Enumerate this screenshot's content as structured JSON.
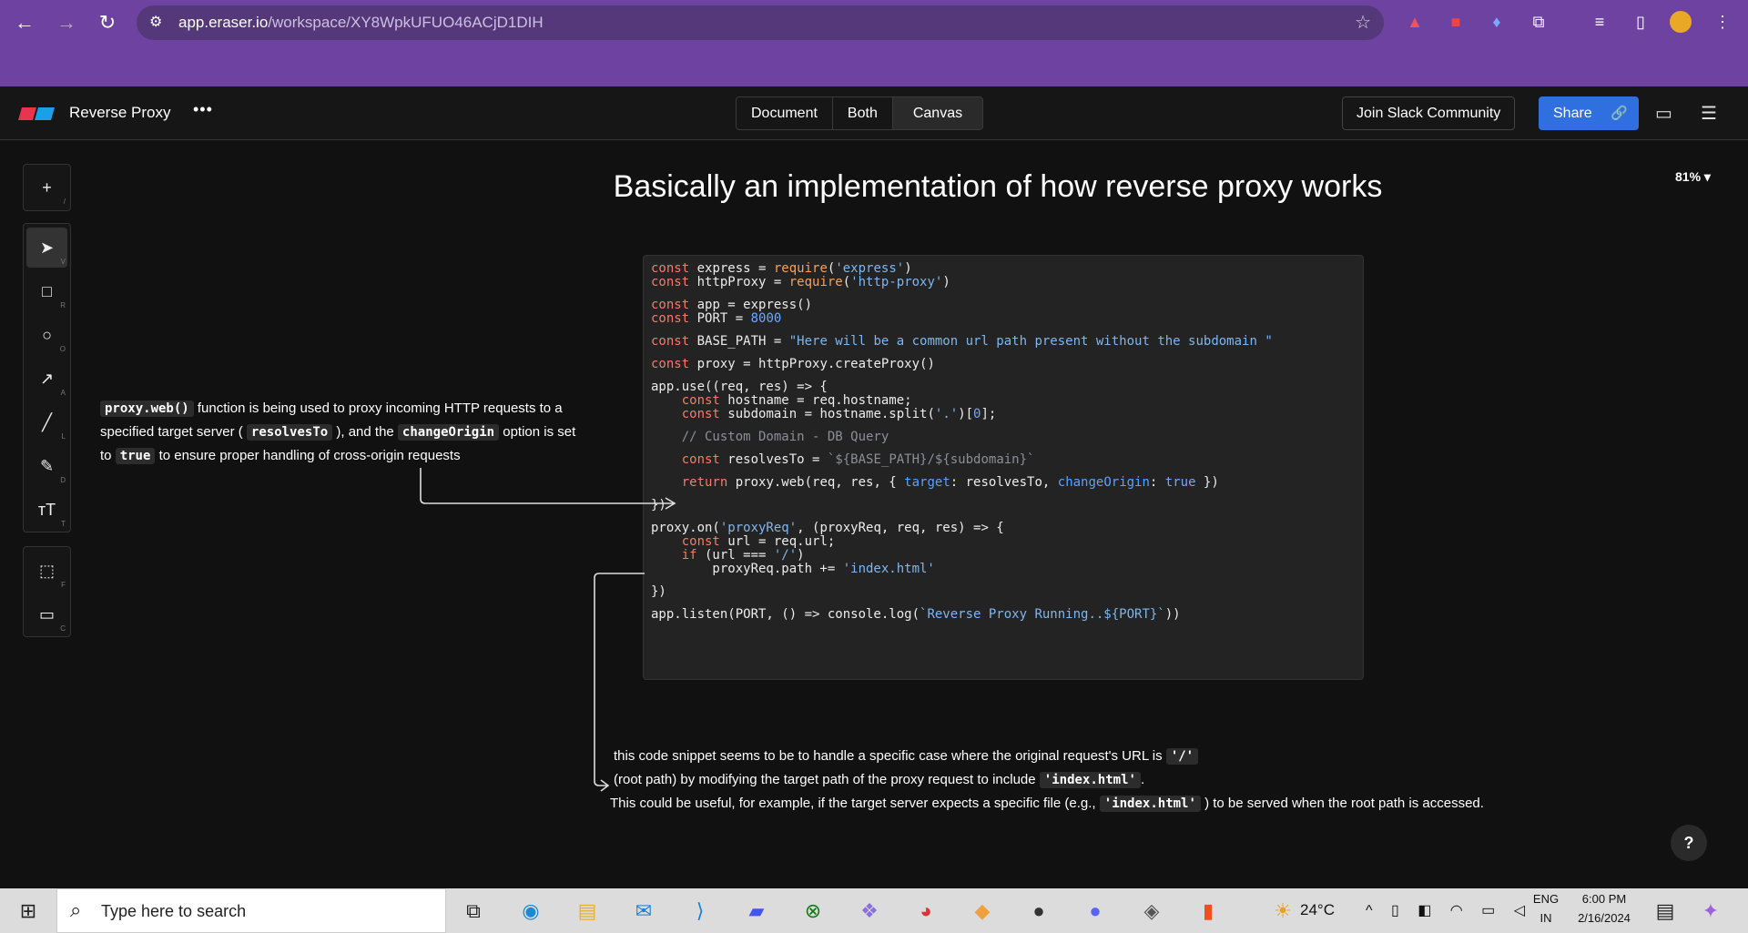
{
  "browser": {
    "url_host": "app.eraser.io",
    "url_path": "/workspace/XY8WpkUFUO46ACjD1DIH"
  },
  "header": {
    "title": "Reverse Proxy",
    "more": "•••",
    "views": [
      "Document",
      "Both",
      "Canvas"
    ],
    "active_view": "Canvas",
    "slack": "Join Slack Community",
    "share": "Share"
  },
  "toolbar": {
    "add_shortcut": "/",
    "tools": [
      {
        "icon": "cursor-icon",
        "key": "V"
      },
      {
        "icon": "rectangle-icon",
        "key": "R"
      },
      {
        "icon": "circle-icon",
        "key": "O"
      },
      {
        "icon": "arrow-icon",
        "key": "A"
      },
      {
        "icon": "line-icon",
        "key": "L"
      },
      {
        "icon": "pencil-icon",
        "key": "D"
      },
      {
        "icon": "text-icon",
        "key": "T"
      }
    ],
    "extra": [
      {
        "icon": "frame-icon",
        "key": "F"
      },
      {
        "icon": "comment-icon",
        "key": "C"
      }
    ]
  },
  "canvas": {
    "title": "Basically an implementation of how reverse proxy works",
    "zoom": "81%",
    "code": [
      [
        [
          "const",
          "kw"
        ],
        [
          " express = ",
          ""
        ],
        [
          "require",
          "fn"
        ],
        [
          "(",
          ""
        ],
        [
          "'express'",
          "st"
        ],
        [
          ")",
          ""
        ]
      ],
      [
        [
          "const",
          "kw"
        ],
        [
          " httpProxy = ",
          ""
        ],
        [
          "require",
          "fn"
        ],
        [
          "(",
          ""
        ],
        [
          "'http-proxy'",
          "st"
        ],
        [
          ")",
          ""
        ]
      ],
      [],
      [
        [
          "const",
          "kw"
        ],
        [
          " app = express()",
          ""
        ]
      ],
      [
        [
          "const",
          "kw"
        ],
        [
          " PORT = ",
          ""
        ],
        [
          "8000",
          "nm"
        ]
      ],
      [],
      [
        [
          "const",
          "kw"
        ],
        [
          " BASE_PATH = ",
          ""
        ],
        [
          "\"Here will be a common url path present without the subdomain \"",
          "st"
        ]
      ],
      [],
      [
        [
          "const",
          "kw"
        ],
        [
          " proxy = httpProxy.createProxy()",
          ""
        ]
      ],
      [],
      [
        [
          "app.use((req, res) => {",
          ""
        ]
      ],
      [
        [
          "    ",
          ""
        ],
        [
          "const",
          "kw"
        ],
        [
          " hostname = req.hostname;",
          ""
        ]
      ],
      [
        [
          "    ",
          ""
        ],
        [
          "const",
          "kw"
        ],
        [
          " subdomain = hostname.split(",
          ""
        ],
        [
          "'.'",
          "st"
        ],
        [
          ")[",
          ""
        ],
        [
          "0",
          "nm"
        ],
        [
          "];",
          ""
        ]
      ],
      [],
      [
        [
          "    ",
          ""
        ],
        [
          "// Custom Domain - DB Query",
          "cm"
        ]
      ],
      [],
      [
        [
          "    ",
          ""
        ],
        [
          "const",
          "kw"
        ],
        [
          " resolvesTo = ",
          ""
        ],
        [
          "`${BASE_PATH}/${subdomain}`",
          "cm"
        ]
      ],
      [],
      [
        [
          "    ",
          ""
        ],
        [
          "return",
          "kw"
        ],
        [
          " proxy.web(req, res, { ",
          ""
        ],
        [
          "target",
          "pr"
        ],
        [
          ": resolvesTo, ",
          ""
        ],
        [
          "changeOrigin",
          "pr"
        ],
        [
          ": ",
          ""
        ],
        [
          "true",
          "nm"
        ],
        [
          " })",
          ""
        ]
      ],
      [],
      [
        [
          "})",
          ""
        ]
      ],
      [],
      [
        [
          "proxy.on(",
          ""
        ],
        [
          "'proxyReq'",
          "st"
        ],
        [
          ", (proxyReq, req, res) => {",
          ""
        ]
      ],
      [
        [
          "    ",
          ""
        ],
        [
          "const",
          "kw"
        ],
        [
          " url = req.url;",
          ""
        ]
      ],
      [
        [
          "    ",
          ""
        ],
        [
          "if",
          "kw"
        ],
        [
          " (url === ",
          ""
        ],
        [
          "'/'",
          "st"
        ],
        [
          ")",
          ""
        ]
      ],
      [
        [
          "        proxyReq.path += ",
          ""
        ],
        [
          "'index.html'",
          "st"
        ]
      ],
      [],
      [
        [
          "})",
          ""
        ]
      ],
      [],
      [
        [
          "app.listen(PORT, () => console.log(",
          ""
        ],
        [
          "`Reverse Proxy Running..${PORT}`",
          "st"
        ],
        [
          "))",
          ""
        ]
      ]
    ],
    "note1": {
      "c1": "proxy.web()",
      "t1": " function is being used to proxy incoming HTTP requests to a",
      "t2": "specified target server ( ",
      "c2": "resolvesTo",
      "t3": " ), and the ",
      "c3": "changeOrigin",
      "t4": " option is set",
      "t5": "to ",
      "c4": "true",
      "t6": " to ensure proper handling of cross-origin requests"
    },
    "note2": {
      "t1": "this code snippet seems to be to handle a specific case where the original request's URL is ",
      "c1": "'/'",
      "t2": "(root path) by modifying the target path of the proxy request to include ",
      "c2": "'index.html'",
      "t3": ".",
      "t4": "This could be useful, for example, if the target server expects a specific file (e.g., ",
      "c3": "'index.html'",
      "t5": " ) to be served when the root path is accessed."
    },
    "help": "?"
  },
  "taskbar": {
    "search_placeholder": "Type here to search",
    "weather": "24°C",
    "lang1": "ENG",
    "lang2": "IN",
    "time": "6:00 PM",
    "date": "2/16/2024"
  },
  "colors": {
    "browser": "#6e42a0",
    "share": "#2f6fe0",
    "keyword": "#f47b6b",
    "string": "#7fb6ee"
  }
}
